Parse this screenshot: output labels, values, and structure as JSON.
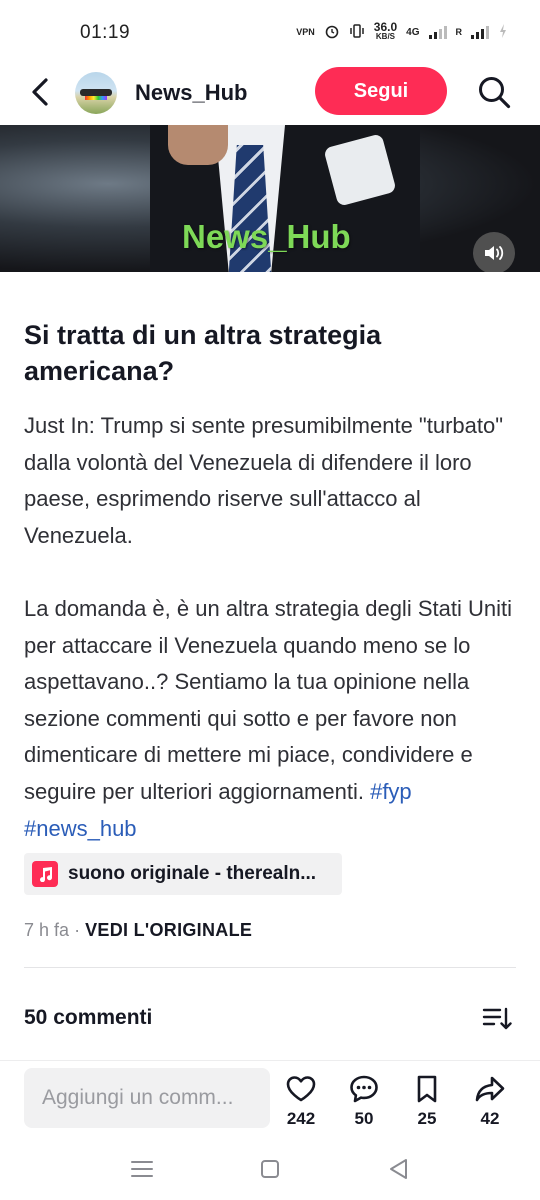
{
  "status": {
    "time": "01:19",
    "vpn": "VPN",
    "speed_value": "36.0",
    "speed_unit": "KB/S",
    "net": "4G",
    "roaming": "R"
  },
  "header": {
    "username": "News_Hub",
    "follow_label": "Segui"
  },
  "video": {
    "watermark": "News_Hub"
  },
  "post": {
    "title": "Si tratta di un altra strategia americana?",
    "description": "Just In: Trump si sente presumibilmente \"turbato\" dalla volontà del Venezuela di difendere il loro paese, esprimendo riserve sull'attacco al Venezuela.\n\nLa domanda è, è un altra strategia degli Stati Uniti per attaccare il Venezuela quando meno se lo aspettavano..? Sentiamo la tua opinione nella sezione commenti qui sotto e per favore non dimenticare di mettere mi piace, condividere e seguire per ulteriori aggiornamenti. ",
    "hashtags": [
      "#fyp",
      "#news_hub"
    ],
    "sound": "suono originale - therealn...",
    "time_ago": "7 h fa",
    "separator": "·",
    "view_original": "VEDI L'ORIGINALE"
  },
  "comments": {
    "title": "50 commenti"
  },
  "bottom_bar": {
    "placeholder": "Aggiungi un comm...",
    "likes": "242",
    "comments": "50",
    "saves": "25",
    "shares": "42"
  },
  "colors": {
    "accent": "#fe2c55",
    "hashtag": "#2b5db8",
    "watermark": "#7ed957"
  },
  "icons": [
    "back-icon",
    "search-icon",
    "speaker-icon",
    "music-note-icon",
    "sort-icon",
    "heart-icon",
    "comment-bubble-icon",
    "bookmark-icon",
    "share-arrow-icon",
    "menu-nav-icon",
    "home-nav-icon",
    "back-nav-icon"
  ]
}
